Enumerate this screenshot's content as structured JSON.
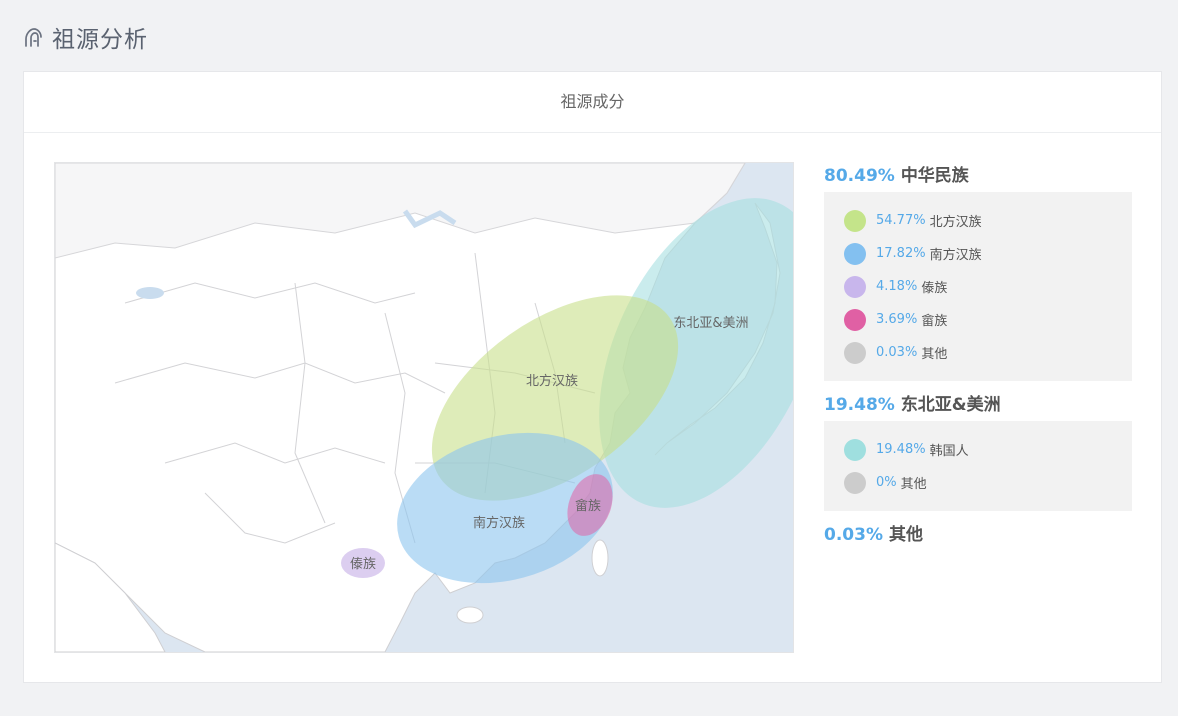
{
  "header": {
    "title": "祖源分析",
    "icon": "tree-icon"
  },
  "card": {
    "title": "祖源成分"
  },
  "map": {
    "labels": {
      "north_han": "北方汉族",
      "south_han": "南方汉族",
      "dai": "傣族",
      "she": "畲族",
      "ne_asia": "东北亚&美洲"
    },
    "colors": {
      "north_han": "#c8e08a",
      "south_han": "#8cc4ef",
      "dai": "#cdb9ea",
      "she": "#e262a5",
      "ne_asia": "#a7dfe1",
      "sea": "#dce6f1",
      "land": "#ffffff",
      "border": "#cfcfd2"
    }
  },
  "legend": {
    "groups": [
      {
        "pct": "80.49%",
        "name": "中华民族",
        "items": [
          {
            "pct": "54.77%",
            "name": "北方汉族",
            "color": "#c4e48a"
          },
          {
            "pct": "17.82%",
            "name": "南方汉族",
            "color": "#83c0f0"
          },
          {
            "pct": "4.18%",
            "name": "傣族",
            "color": "#c8b6ec"
          },
          {
            "pct": "3.69%",
            "name": "畲族",
            "color": "#e060a4"
          },
          {
            "pct": "0.03%",
            "name": "其他",
            "color": "#cccccc"
          }
        ]
      },
      {
        "pct": "19.48%",
        "name": "东北亚&美洲",
        "items": [
          {
            "pct": "19.48%",
            "name": "韩国人",
            "color": "#9fdfdf"
          },
          {
            "pct": "0%",
            "name": "其他",
            "color": "#cccccc"
          }
        ]
      },
      {
        "pct": "0.03%",
        "name": "其他",
        "items": []
      }
    ]
  }
}
